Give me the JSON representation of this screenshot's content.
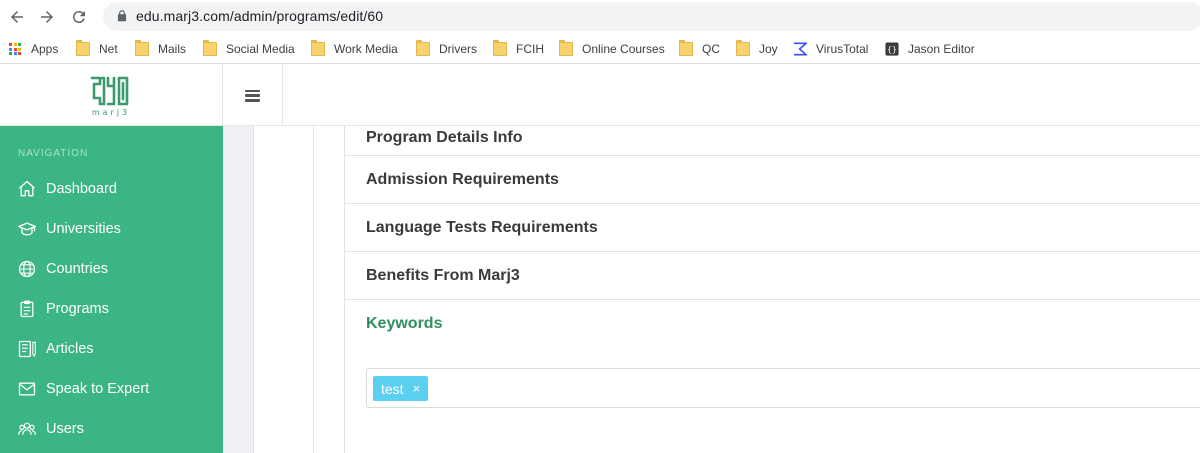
{
  "browser": {
    "url": "edu.marj3.com/admin/programs/edit/60",
    "bookmarks": [
      {
        "label": "Apps",
        "icon": "apps-grid-icon"
      },
      {
        "label": "Net",
        "icon": "folder-icon"
      },
      {
        "label": "Mails",
        "icon": "folder-icon"
      },
      {
        "label": "Social Media",
        "icon": "folder-icon"
      },
      {
        "label": "Work Media",
        "icon": "folder-icon"
      },
      {
        "label": "Drivers",
        "icon": "folder-icon"
      },
      {
        "label": "FCIH",
        "icon": "folder-icon"
      },
      {
        "label": "Online Courses",
        "icon": "folder-icon"
      },
      {
        "label": "QC",
        "icon": "folder-icon"
      },
      {
        "label": "Joy",
        "icon": "folder-icon"
      },
      {
        "label": "VirusTotal",
        "icon": "virustotal-icon"
      },
      {
        "label": "Jason Editor",
        "icon": "json-editor-icon"
      }
    ]
  },
  "header": {
    "logo_text": "marj3",
    "menu_icon": "hamburger-icon"
  },
  "sidebar": {
    "heading": "NAVIGATION",
    "items": [
      {
        "label": "Dashboard",
        "icon": "home-icon"
      },
      {
        "label": "Universities",
        "icon": "graduation-cap-icon"
      },
      {
        "label": "Countries",
        "icon": "globe-icon"
      },
      {
        "label": "Programs",
        "icon": "clipboard-icon"
      },
      {
        "label": "Articles",
        "icon": "article-icon"
      },
      {
        "label": "Speak to Expert",
        "icon": "envelope-icon"
      },
      {
        "label": "Users",
        "icon": "users-icon"
      }
    ]
  },
  "main": {
    "sections": [
      {
        "label": "Program Details Info"
      },
      {
        "label": "Admission Requirements"
      },
      {
        "label": "Language Tests Requirements"
      },
      {
        "label": "Benefits From Marj3"
      },
      {
        "label": "Keywords"
      }
    ],
    "keywords": {
      "tags": [
        {
          "label": "test",
          "remove": "×"
        }
      ]
    }
  },
  "colors": {
    "sidebar_bg": "#3bb582",
    "active_section": "#2f8f5f",
    "tag_bg": "#5bd0f0",
    "bookmark_folder": "#f6d36e"
  }
}
